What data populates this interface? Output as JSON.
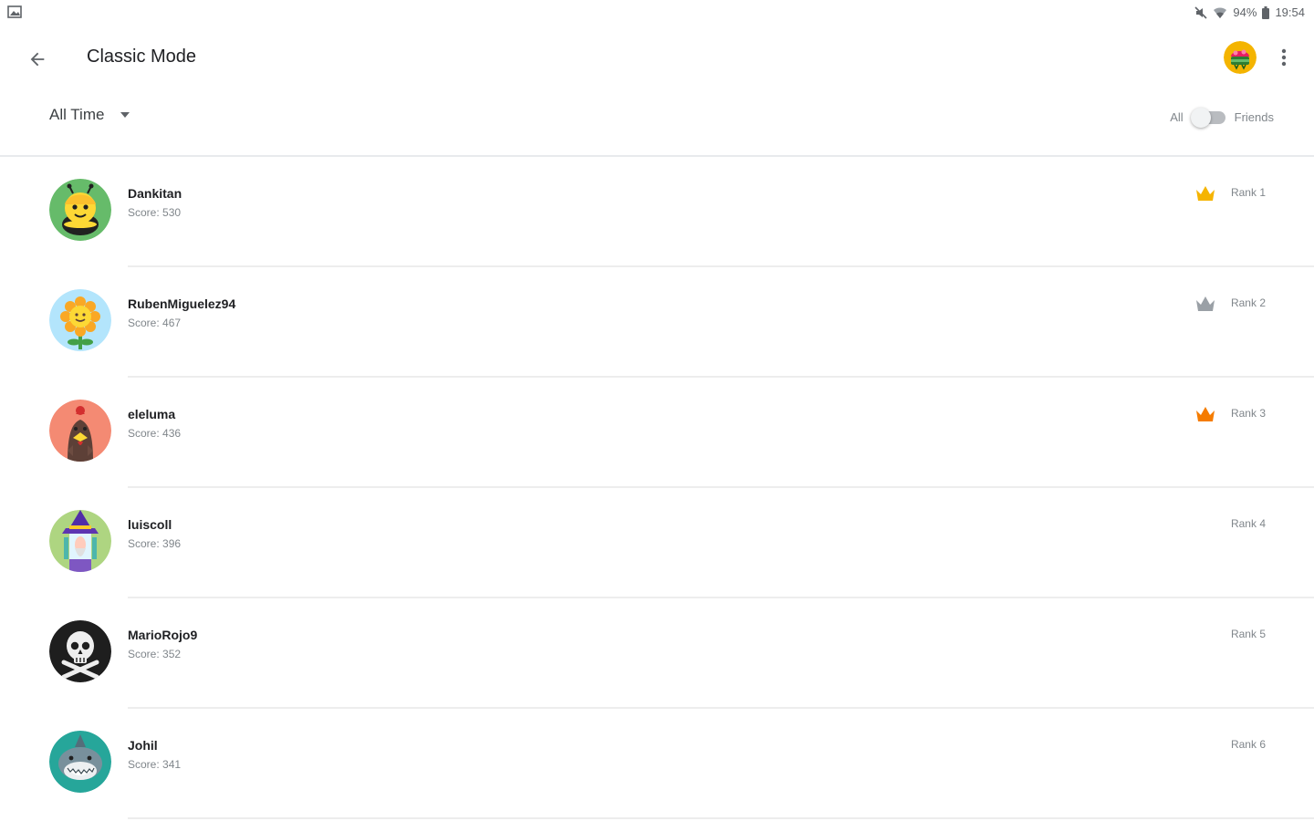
{
  "status_bar": {
    "battery": "94%",
    "time": "19:54"
  },
  "app_bar": {
    "title": "Classic Mode"
  },
  "filter": {
    "timeframe": "All Time",
    "toggle_left": "All",
    "toggle_right": "Friends"
  },
  "players": [
    {
      "name": "Dankitan",
      "score": "Score: 530",
      "rank": "Rank 1",
      "crown": "gold",
      "crown_color": "#f5b400"
    },
    {
      "name": "RubenMiguelez94",
      "score": "Score: 467",
      "rank": "Rank 2",
      "crown": "silver",
      "crown_color": "#9aa0a6"
    },
    {
      "name": "eleluma",
      "score": "Score: 436",
      "rank": "Rank 3",
      "crown": "bronze",
      "crown_color": "#f57c00"
    },
    {
      "name": "luiscoll",
      "score": "Score: 396",
      "rank": "Rank 4"
    },
    {
      "name": "MarioRojo9",
      "score": "Score: 352",
      "rank": "Rank 5"
    },
    {
      "name": "Johil",
      "score": "Score: 341",
      "rank": "Rank 6"
    }
  ]
}
